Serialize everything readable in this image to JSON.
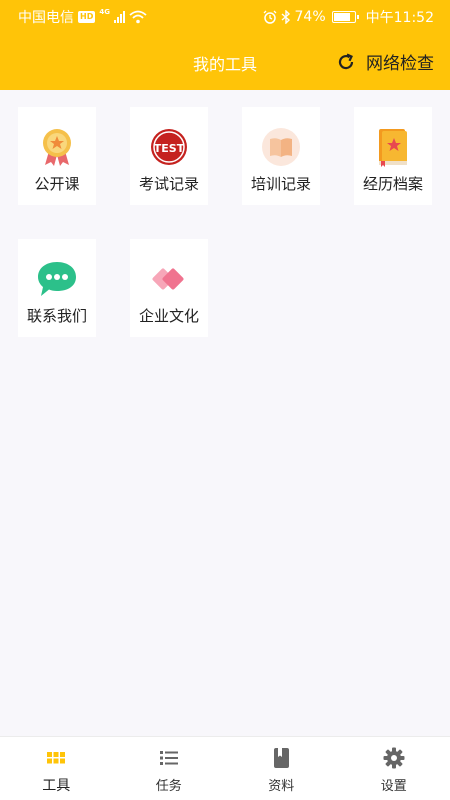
{
  "status_bar": {
    "carrier": "中国电信",
    "hd": "HD",
    "network": "4G",
    "battery": "74%",
    "time": "中午11:52"
  },
  "header": {
    "title": "我的工具",
    "net_check_label": "网络检查",
    "bg_color": "#ffc408"
  },
  "tools": [
    {
      "label": "公开课",
      "icon": "medal-icon"
    },
    {
      "label": "考试记录",
      "icon": "test-icon"
    },
    {
      "label": "培训记录",
      "icon": "book-open-icon"
    },
    {
      "label": "经历档案",
      "icon": "book-star-icon"
    },
    {
      "label": "联系我们",
      "icon": "chat-icon"
    },
    {
      "label": "企业文化",
      "icon": "heart-icon"
    }
  ],
  "bottom_nav": [
    {
      "label": "工具",
      "icon": "grid-icon",
      "active": true
    },
    {
      "label": "任务",
      "icon": "list-icon",
      "active": false
    },
    {
      "label": "资料",
      "icon": "book-icon",
      "active": false
    },
    {
      "label": "设置",
      "icon": "gear-icon",
      "active": false
    }
  ],
  "colors": {
    "accent": "#ffc408",
    "nav_inactive": "#666666"
  }
}
